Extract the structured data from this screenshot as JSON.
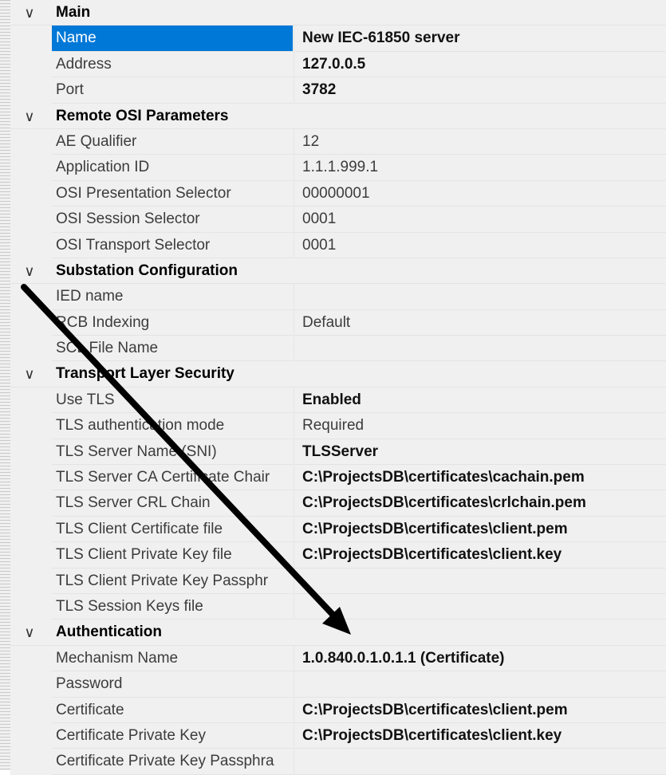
{
  "categories": [
    {
      "title": "Main",
      "props": [
        {
          "name": "Name",
          "value": "New IEC-61850 server",
          "bold": true,
          "selected": true
        },
        {
          "name": "Address",
          "value": "127.0.0.5",
          "bold": true
        },
        {
          "name": "Port",
          "value": "3782",
          "bold": true
        }
      ]
    },
    {
      "title": "Remote OSI Parameters",
      "props": [
        {
          "name": "AE Qualifier",
          "value": "12"
        },
        {
          "name": "Application ID",
          "value": "1.1.1.999.1"
        },
        {
          "name": "OSI Presentation Selector",
          "value": "00000001"
        },
        {
          "name": "OSI Session Selector",
          "value": "0001"
        },
        {
          "name": "OSI Transport Selector",
          "value": "0001"
        }
      ]
    },
    {
      "title": "Substation Configuration",
      "props": [
        {
          "name": "IED name",
          "value": ""
        },
        {
          "name": "RCB Indexing",
          "value": "Default"
        },
        {
          "name": "SCL File Name",
          "value": ""
        }
      ]
    },
    {
      "title": "Transport Layer Security",
      "props": [
        {
          "name": "Use TLS",
          "value": "Enabled",
          "bold": true
        },
        {
          "name": "TLS authentication mode",
          "value": "Required"
        },
        {
          "name": "TLS Server Name (SNI)",
          "value": "TLSServer",
          "bold": true
        },
        {
          "name": "TLS Server CA Certificate Chair",
          "value": "C:\\ProjectsDB\\certificates\\cachain.pem",
          "bold": true
        },
        {
          "name": "TLS Server CRL Chain",
          "value": "C:\\ProjectsDB\\certificates\\crlchain.pem",
          "bold": true
        },
        {
          "name": "TLS Client Certificate file",
          "value": "C:\\ProjectsDB\\certificates\\client.pem",
          "bold": true
        },
        {
          "name": "TLS Client Private Key file",
          "value": "C:\\ProjectsDB\\certificates\\client.key",
          "bold": true
        },
        {
          "name": "TLS Client Private Key Passphr",
          "value": ""
        },
        {
          "name": "TLS Session Keys file",
          "value": ""
        }
      ]
    },
    {
      "title": "Authentication",
      "props": [
        {
          "name": "Mechanism Name",
          "value": "1.0.840.0.1.0.1.1 (Certificate)",
          "bold": true
        },
        {
          "name": "Password",
          "value": ""
        },
        {
          "name": "Certificate",
          "value": "C:\\ProjectsDB\\certificates\\client.pem",
          "bold": true
        },
        {
          "name": "Certificate Private Key",
          "value": "C:\\ProjectsDB\\certificates\\client.key",
          "bold": true
        },
        {
          "name": "Certificate Private Key Passphra",
          "value": ""
        }
      ]
    }
  ],
  "icons": {
    "expanded": "chevron-down-icon"
  },
  "colors": {
    "selection": "#0078d7",
    "grid_bg": "#f0f0f0",
    "arrow": "#000000"
  }
}
